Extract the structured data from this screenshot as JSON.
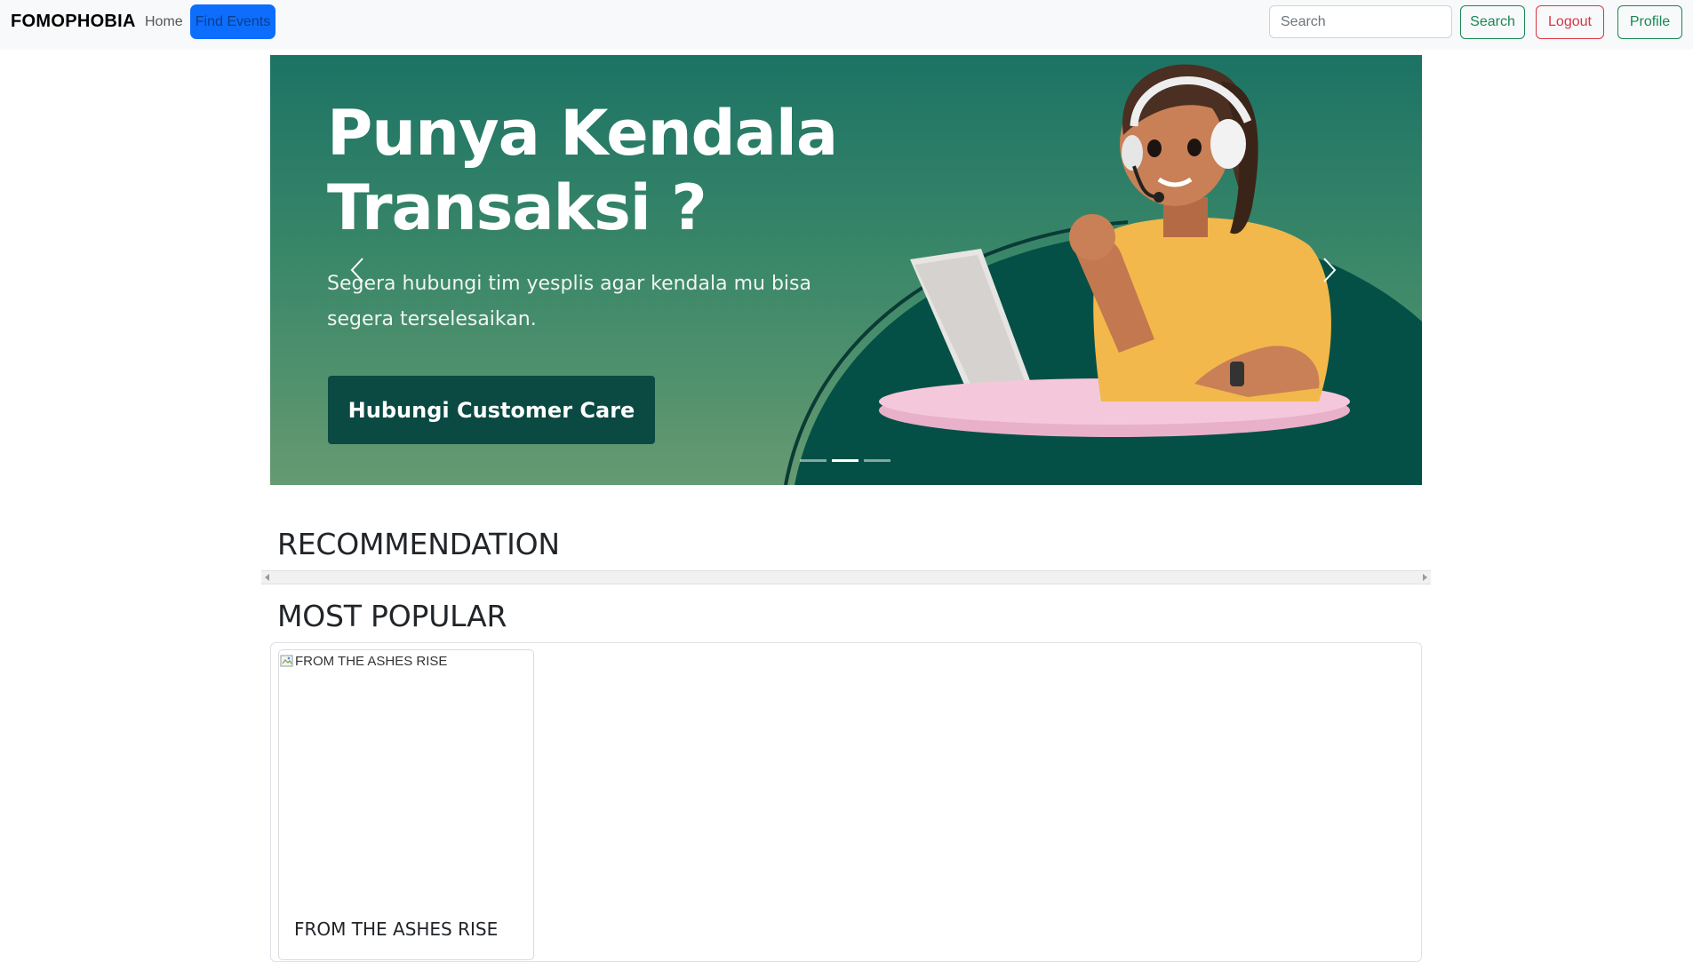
{
  "navbar": {
    "brand": "FOMOPHOBIA",
    "links": [
      {
        "label": "Home"
      },
      {
        "label": "Find Events"
      }
    ],
    "search": {
      "placeholder": "Search",
      "value": ""
    },
    "search_button": "Search",
    "logout_button": "Logout",
    "profile_button": "Profile"
  },
  "carousel": {
    "slide": {
      "title_line1": "Punya Kendala",
      "title_line2": "Transaksi ?",
      "subtitle": "Segera hubungi tim yesplis agar kendala mu bisa segera terselesaikan.",
      "cta": "Hubungi Customer Care"
    },
    "indicator_count": 3,
    "active_index": 1
  },
  "sections": {
    "recommendation_title": "RECOMMENDATION",
    "most_popular_title": "MOST POPULAR"
  },
  "events": [
    {
      "title": "FROM THE ASHES RISE",
      "image_alt": "FROM THE ASHES RISE"
    }
  ],
  "colors": {
    "primary": "#0d6efd",
    "success": "#198754",
    "danger": "#dc3545",
    "banner_green": "#1c7364",
    "cta_dark": "#0a4a43",
    "shirt_yellow": "#f2b84b"
  }
}
